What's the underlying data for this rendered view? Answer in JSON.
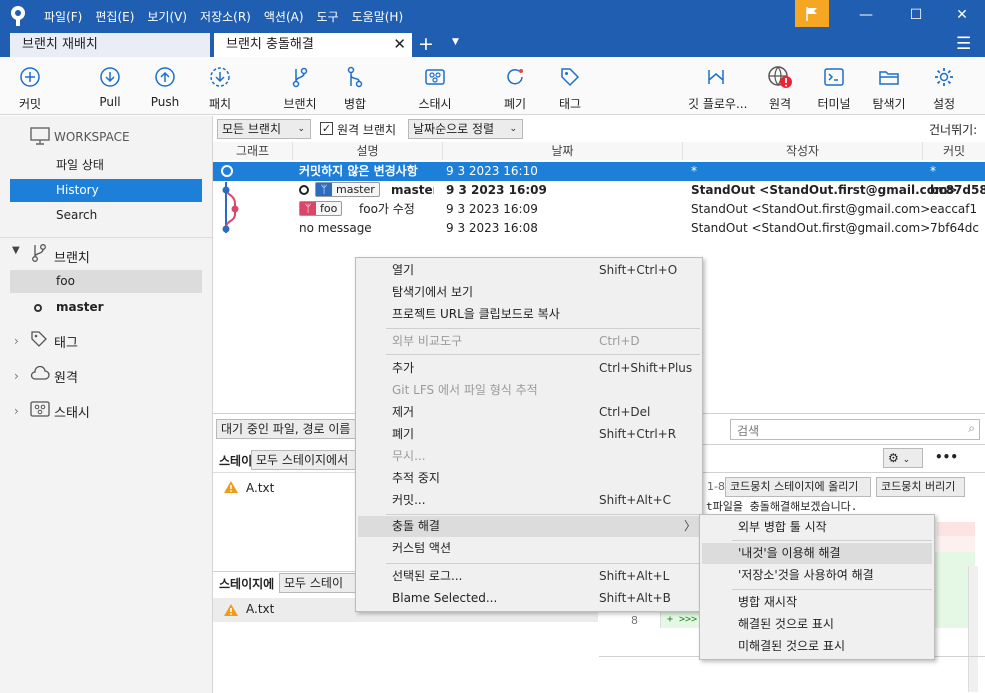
{
  "titlebar": {
    "menus": [
      "파일(F)",
      "편집(E)",
      "보기(V)",
      "저장소(R)",
      "액션(A)",
      "도구",
      "도움말(H)"
    ],
    "controls": {
      "minimize": "—",
      "maximize": "☐",
      "close": "✕"
    }
  },
  "tabs": [
    {
      "label": "브랜치 재배치"
    },
    {
      "label": "브랜치 충돌해결"
    }
  ],
  "tabbar": {
    "add": "+",
    "menu_caret": "▼",
    "hamburger": "☰",
    "close": "✕"
  },
  "toolbar": {
    "commit": "커밋",
    "pull": "Pull",
    "push": "Push",
    "fetch": "패치",
    "branch": "브랜치",
    "merge": "병합",
    "stash": "스태시",
    "discard": "폐기",
    "tag": "태그",
    "git_flow": "깃 플로우...",
    "remote": "원격",
    "terminal": "터미널",
    "explorer": "탐색기",
    "settings": "설정"
  },
  "sidebar": {
    "workspace": "WORKSPACE",
    "file_status": "파일 상태",
    "history": "History",
    "search": "Search",
    "branches_header": "브랜치",
    "branches": [
      "foo",
      "master"
    ],
    "tags_header": "태그",
    "remotes_header": "원격",
    "stash_header": "스태시"
  },
  "filters": {
    "all_branches": "모든 브랜치",
    "remote_branches": "원격 브랜치",
    "sort": "날짜순으로 정렬",
    "jump": "건너뛰기:"
  },
  "columns": {
    "graph": "그래프",
    "desc": "설명",
    "date": "날짜",
    "author": "작성자",
    "commit": "커밋"
  },
  "commits": [
    {
      "desc": "커밋하지 않은 변경사항",
      "date": "9 3 2023 16:10",
      "author": "*",
      "hash": "*"
    },
    {
      "tag": "master",
      "desc": "master",
      "date": "9 3 2023 16:09",
      "author": "StandOut <StandOut.first@gmail.com>",
      "hash": "bc87d58"
    },
    {
      "tag": "foo",
      "desc": "foo가 수정",
      "date": "9 3 2023 16:09",
      "author": "StandOut <StandOut.first@gmail.com>",
      "hash": "eaccaf1"
    },
    {
      "desc": "no message",
      "date": "9 3 2023 16:08",
      "author": "StandOut <StandOut.first@gmail.com>",
      "hash": "7bf64dc"
    }
  ],
  "lower": {
    "pending_filter": "대기 중인 파일, 경로 이름",
    "search_placeholder": "검색",
    "unstaged_label": "스테이",
    "stage_all": "모두 스테이지에서",
    "unstaged_file": "A.txt",
    "staged_label": "스테이지에",
    "staged_all": "모두 스테이",
    "staged_file": "A.txt",
    "hunk_range": "1-8",
    "stage_hunk": "코드뭉치 스테이지에 올리기",
    "discard_hunk": "코드뭉치 버리기",
    "diff_text": "t파일을 충돌해결해보겠습니다.",
    "line_no": "8",
    "conflict_marker": "+ >>>"
  },
  "context_menu": {
    "items": [
      {
        "label": "열기",
        "shortcut": "Shift+Ctrl+O"
      },
      {
        "label": "탐색기에서 보기",
        "shortcut": ""
      },
      {
        "label": "프로젝트 URL을 클립보드로 복사",
        "shortcut": ""
      },
      {
        "label": "외부 비교도구",
        "shortcut": "Ctrl+D",
        "disabled": true
      },
      {
        "label": "추가",
        "shortcut": "Ctrl+Shift+Plus"
      },
      {
        "label": "Git LFS 에서 파일 형식 추적",
        "shortcut": "",
        "disabled": true
      },
      {
        "label": "제거",
        "shortcut": "Ctrl+Del"
      },
      {
        "label": "폐기",
        "shortcut": "Shift+Ctrl+R"
      },
      {
        "label": "무시...",
        "shortcut": "",
        "disabled": true
      },
      {
        "label": "추적 중지",
        "shortcut": ""
      },
      {
        "label": "커밋...",
        "shortcut": "Shift+Alt+C"
      },
      {
        "label": "충돌 해결",
        "shortcut": "",
        "submenu": true
      },
      {
        "label": "커스텀 액션",
        "shortcut": ""
      },
      {
        "label": "선택된 로그...",
        "shortcut": "Shift+Alt+L"
      },
      {
        "label": "Blame Selected...",
        "shortcut": "Shift+Alt+B"
      }
    ],
    "submenu_arrow": "〉"
  },
  "submenu": {
    "items": [
      "외부 병합 툴 시작",
      "'내것'을 이용해 해결",
      "'저장소'것을 사용하여 해결",
      "병합 재시작",
      "해결된 것으로 표시",
      "미해결된 것으로 표시"
    ]
  },
  "colors": {
    "brand": "#1f5eb1",
    "accent": "#1e7fd8",
    "flag": "#f5a623"
  }
}
